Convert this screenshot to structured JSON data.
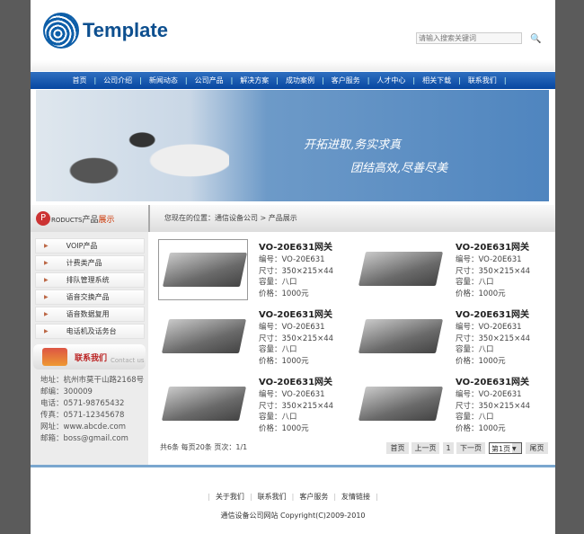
{
  "header": {
    "logo_text": "Template",
    "search_placeholder": "请输入搜索关键词",
    "search_icon": "magnifier-icon"
  },
  "nav": [
    "首页",
    "公司介绍",
    "新闻动态",
    "公司产品",
    "解决方案",
    "成功案例",
    "客户服务",
    "人才中心",
    "相关下载",
    "联系我们"
  ],
  "banner": {
    "slogan1": "开拓进取,务实求真",
    "slogan2": "团结高效,尽善尽美"
  },
  "sidebar": {
    "products_p": "P",
    "products_en": "RODUCTS",
    "products_cn1": "产品",
    "products_cn2": "展示",
    "categories": [
      "VOIP产品",
      "计费类产品",
      "排队管理系统",
      "语音交换产品",
      "语音数据复用",
      "电话机及话务台"
    ],
    "contact_title": "联系我们",
    "contact_en": "Contact us",
    "contact_info": [
      "地址：杭州市莫干山路2168号",
      "邮编：300009",
      "电话：0571-98765432",
      "传真：0571-12345678",
      "网址：www.abcde.com",
      "邮箱：boss@gmail.com"
    ]
  },
  "breadcrumb": "您现在的位置：通信设备公司 > 产品展示",
  "products": [
    {
      "name": "VO-20E631网关",
      "code": "编号：VO-20E631",
      "size": "尺寸：350×215×44",
      "capacity": "容量：八口",
      "price": "价格：1000元"
    },
    {
      "name": "VO-20E631网关",
      "code": "编号：VO-20E631",
      "size": "尺寸：350×215×44",
      "capacity": "容量：八口",
      "price": "价格：1000元"
    },
    {
      "name": "VO-20E631网关",
      "code": "编号：VO-20E631",
      "size": "尺寸：350×215×44",
      "capacity": "容量：八口",
      "price": "价格：1000元"
    },
    {
      "name": "VO-20E631网关",
      "code": "编号：VO-20E631",
      "size": "尺寸：350×215×44",
      "capacity": "容量：八口",
      "price": "价格：1000元"
    },
    {
      "name": "VO-20E631网关",
      "code": "编号：VO-20E631",
      "size": "尺寸：350×215×44",
      "capacity": "容量：八口",
      "price": "价格：1000元"
    },
    {
      "name": "VO-20E631网关",
      "code": "编号：VO-20E631",
      "size": "尺寸：350×215×44",
      "capacity": "容量：八口",
      "price": "价格：1000元"
    }
  ],
  "pager": {
    "info": "共6条 每页20条 页次：1/1",
    "first": "首页",
    "prev": "上一页",
    "current": "1",
    "next": "下一页",
    "select": "第1页",
    "last": "尾页"
  },
  "footer": {
    "links": [
      "关于我们",
      "联系我们",
      "客户服务",
      "友情链接"
    ],
    "copyright": "通信设备公司网站 Copyright(C)2009-2010"
  }
}
